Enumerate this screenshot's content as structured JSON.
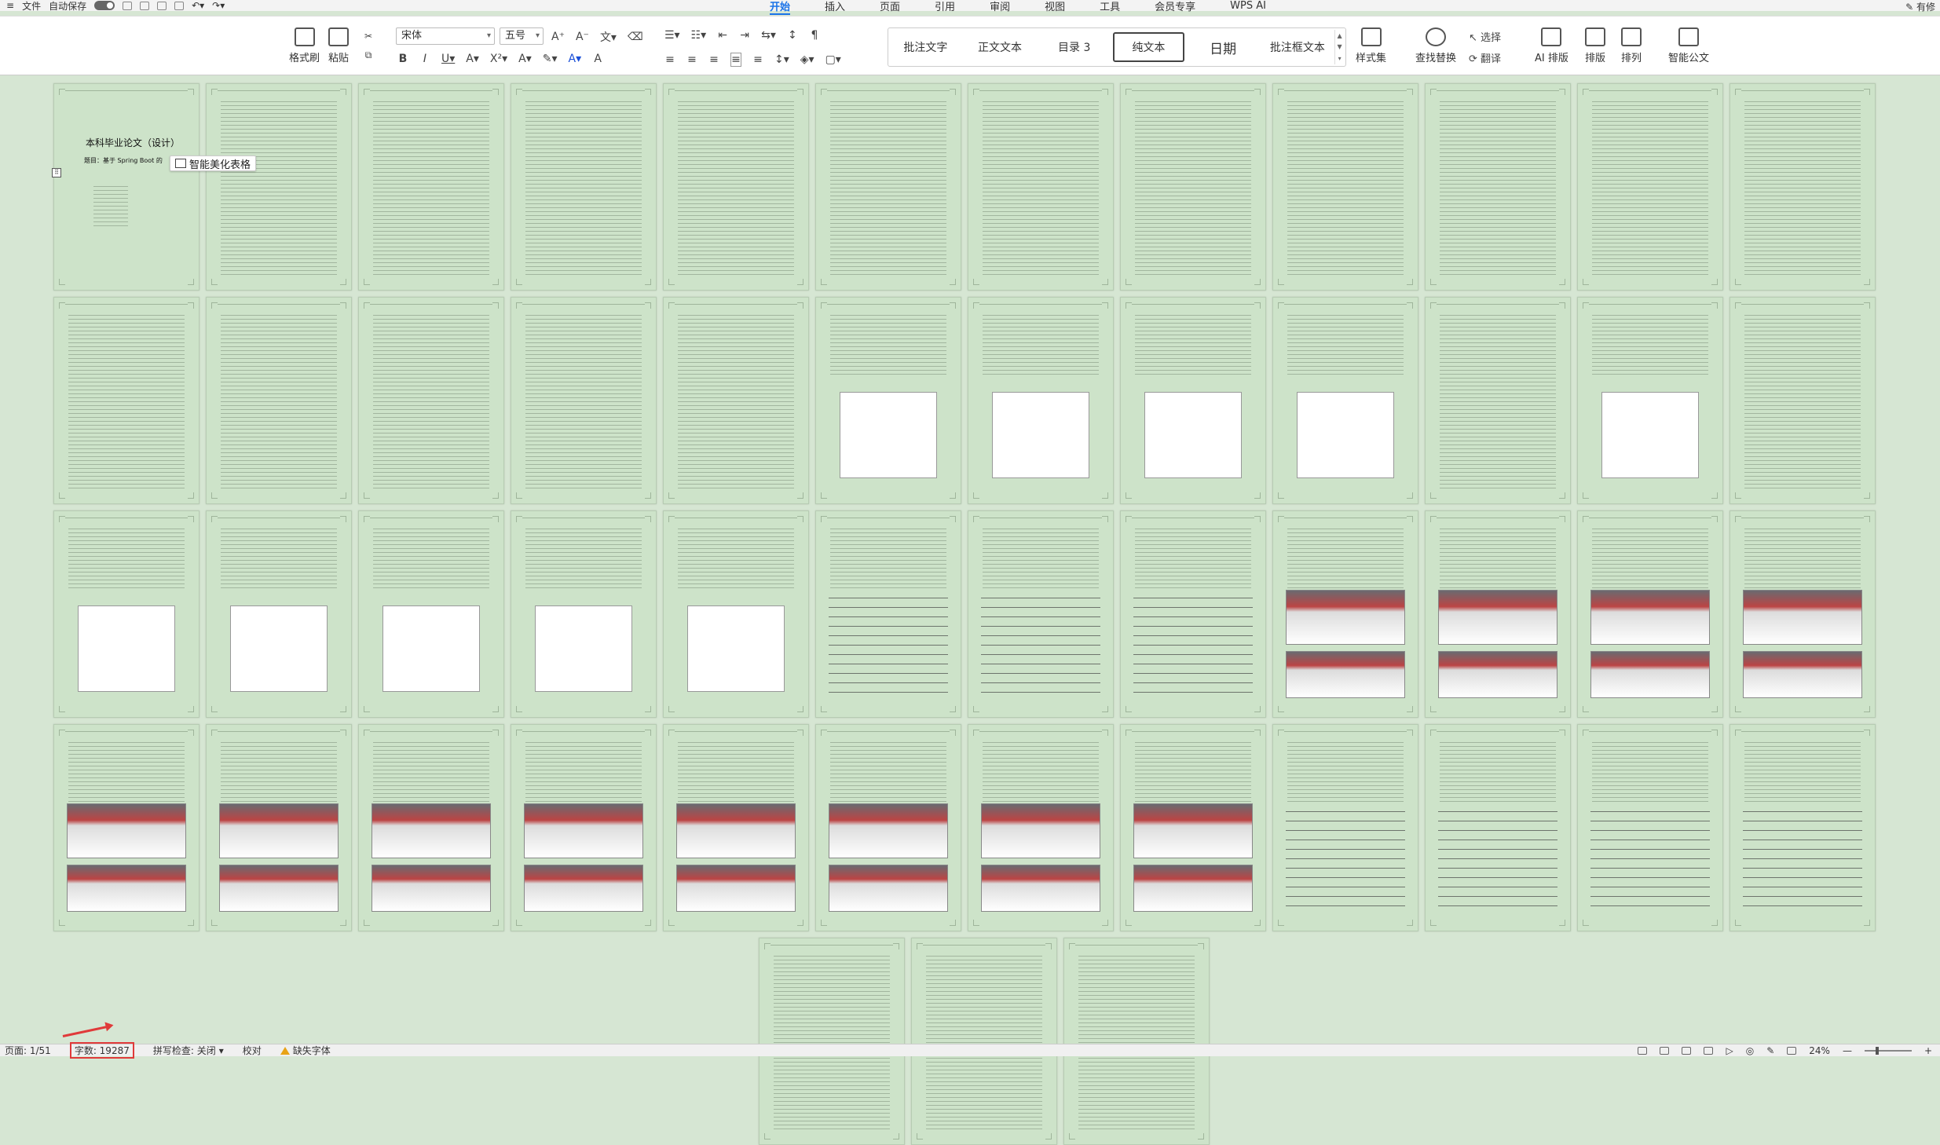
{
  "menubar": {
    "file_label": "文件",
    "autosave_label": "自动保存",
    "tabs": [
      {
        "label": "开始",
        "active": true
      },
      {
        "label": "插入",
        "active": false
      },
      {
        "label": "页面",
        "active": false
      },
      {
        "label": "引用",
        "active": false
      },
      {
        "label": "审阅",
        "active": false
      },
      {
        "label": "视图",
        "active": false
      },
      {
        "label": "工具",
        "active": false
      },
      {
        "label": "会员专享",
        "active": false
      },
      {
        "label": "WPS AI",
        "active": false
      }
    ],
    "right_label": "有修"
  },
  "ribbon": {
    "format_painter": "格式刷",
    "paste": "粘贴",
    "font_name": "宋体",
    "font_size": "五号",
    "styles": [
      {
        "label": "批注文字",
        "selected": false
      },
      {
        "label": "正文文本",
        "selected": false
      },
      {
        "label": "目录 3",
        "selected": false
      },
      {
        "label": "纯文本",
        "selected": true
      },
      {
        "label": "日期",
        "selected": false,
        "big": true
      },
      {
        "label": "批注框文本",
        "selected": false
      }
    ],
    "style_set": "样式集",
    "find_replace": "查找替换",
    "select": "选择",
    "translate": "翻译",
    "ai_layout": "AI 排版",
    "layout": "排版",
    "arrange": "排列",
    "smart_doc": "智能公文"
  },
  "document": {
    "cover_title": "本科毕业论文（设计）",
    "cover_topic_prefix": "题目：",
    "cover_topic": "基于 Spring Boot 的"
  },
  "smart_table_button": "智能美化表格",
  "statusbar": {
    "page": "页面: 1/51",
    "word_count": "字数: 19287",
    "spell_check": "拼写检查: 关闭",
    "proofread": "校对",
    "missing_font": "缺失字体",
    "zoom": "24%"
  },
  "colors": {
    "accent": "#1a73e8",
    "highlight_red": "#e03a3a",
    "warning": "#e8a317",
    "page_bg": "#cde3c9"
  }
}
